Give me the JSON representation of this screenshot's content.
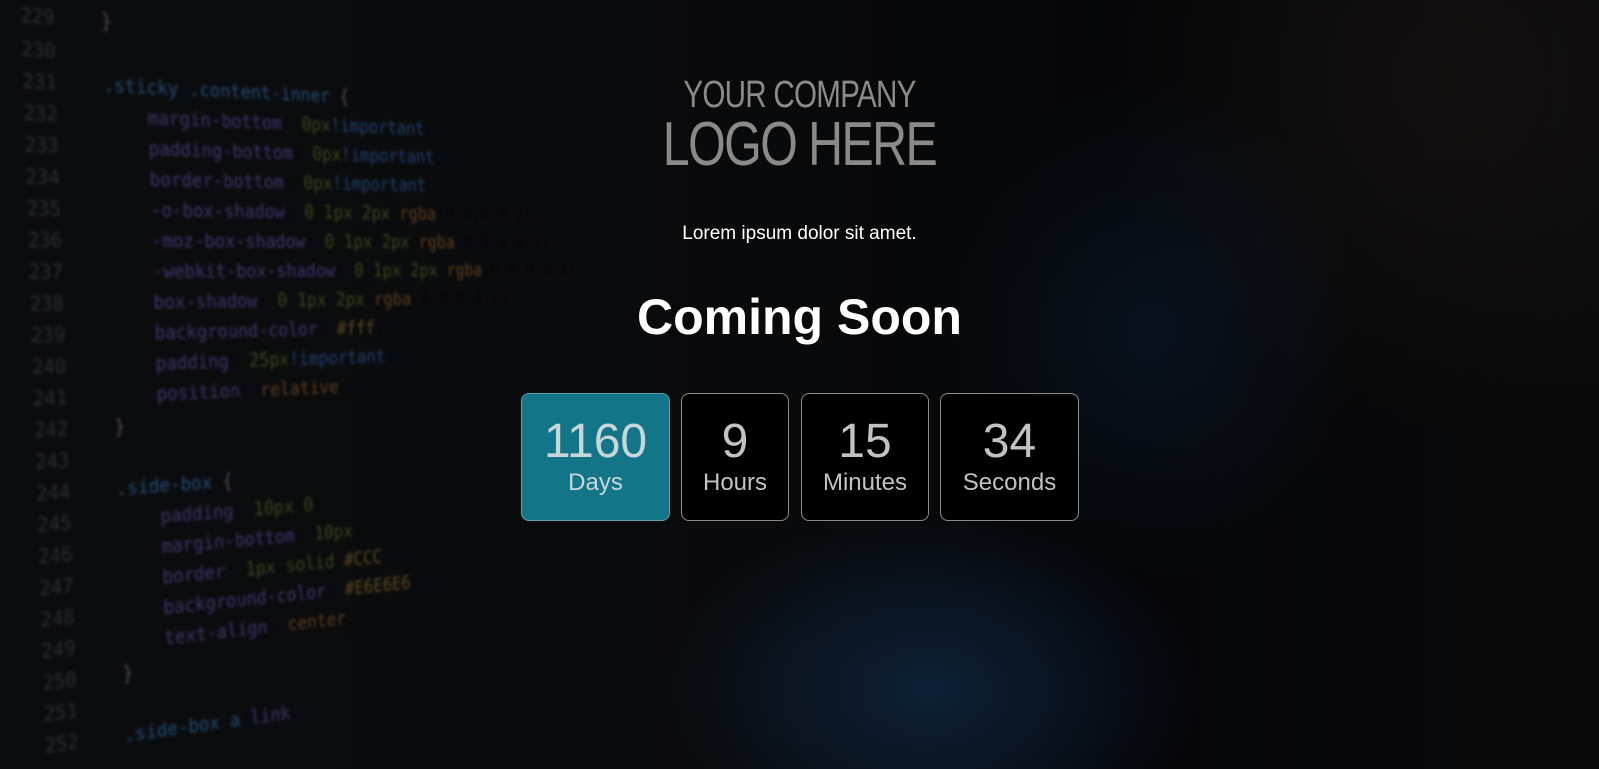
{
  "logo": {
    "line1": "YOUR COMPANY",
    "line2": "LOGO HERE"
  },
  "tagline": "Lorem ipsum dolor sit amet.",
  "heading": "Coming Soon",
  "countdown": [
    {
      "value": "1160",
      "unit": "Days",
      "active": true
    },
    {
      "value": "9",
      "unit": "Hours",
      "active": false
    },
    {
      "value": "15",
      "unit": "Minutes",
      "active": false
    },
    {
      "value": "34",
      "unit": "Seconds",
      "active": false
    }
  ],
  "colors": {
    "active_box": "#127688",
    "box": "#000000",
    "text": "#ffffff"
  }
}
